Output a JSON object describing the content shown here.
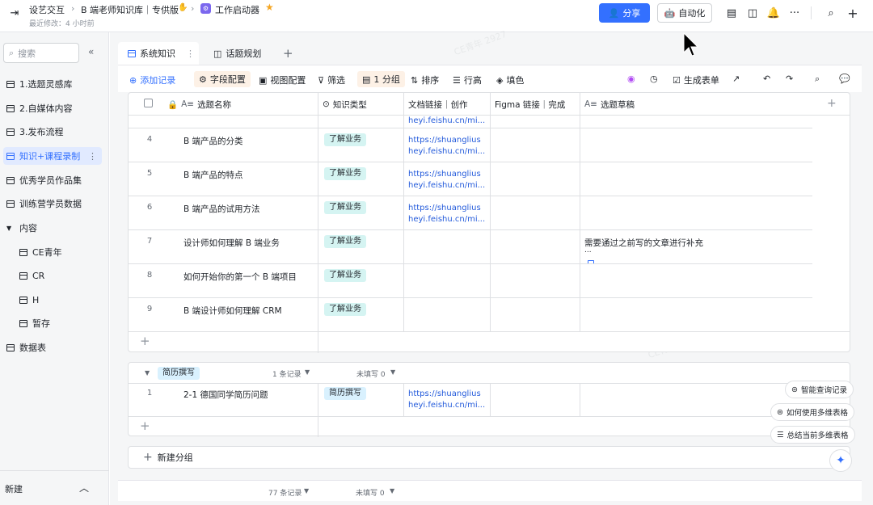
{
  "topbar": {
    "crumbs": [
      "设艺交互",
      "B 端老师知识库｜专供版",
      "工作启动器"
    ],
    "last_modified": "最近修改：4 小时前",
    "share_label": "分享",
    "automation_label": "自动化",
    "star_color": "#f5a623"
  },
  "sidebar": {
    "search_placeholder": "搜索",
    "items": [
      {
        "label": "1.选题灵感库"
      },
      {
        "label": "2.自媒体内容"
      },
      {
        "label": "3.发布流程"
      },
      {
        "label": "知识+课程录制"
      },
      {
        "label": "优秀学员作品集"
      },
      {
        "label": "训练营学员数据"
      },
      {
        "label": "内容"
      },
      {
        "label": "CE青年"
      },
      {
        "label": "CR"
      },
      {
        "label": "H"
      },
      {
        "label": "暂存"
      },
      {
        "label": "数据表"
      }
    ],
    "new_label": "新建"
  },
  "tabs": [
    {
      "label": "系统知识"
    },
    {
      "label": "话题规划"
    }
  ],
  "toolbar": {
    "add_record": "添加记录",
    "field_config": "字段配置",
    "view_config": "视图配置",
    "filter": "筛选",
    "group": "1 分组",
    "sort": "排序",
    "row_height": "行高",
    "fill_color": "填色",
    "generate_form": "生成表单"
  },
  "columns": [
    "选题名称",
    "知识类型",
    "文档链接｜创作",
    "Figma 链接｜完成",
    "选题草稿"
  ],
  "group1": {
    "partial_link": "heyi.feishu.cn/mi...",
    "rows": [
      {
        "num": "4",
        "title": "B 端产品的分类",
        "type": "了解业务",
        "link1": "https://shuanglius",
        "link2": "heyi.feishu.cn/mi...",
        "draft": ""
      },
      {
        "num": "5",
        "title": "B 端产品的特点",
        "type": "了解业务",
        "link1": "https://shuanglius",
        "link2": "heyi.feishu.cn/mi...",
        "draft": ""
      },
      {
        "num": "6",
        "title": "B 端产品的试用方法",
        "type": "了解业务",
        "link1": "https://shuanglius",
        "link2": "heyi.feishu.cn/mi...",
        "draft": ""
      },
      {
        "num": "7",
        "title": "设计师如何理解 B 端业务",
        "type": "了解业务",
        "link1": "",
        "link2": "",
        "draft": "需要通过之前写的文章进行补充",
        "draft_more": "..."
      },
      {
        "num": "8",
        "title": "如何开始你的第一个 B 端项目",
        "type": "了解业务",
        "link1": "",
        "link2": "",
        "draft": ""
      },
      {
        "num": "9",
        "title": "B 端设计师如何理解 CRM",
        "type": "了解业务",
        "link1": "",
        "link2": "",
        "draft": ""
      }
    ]
  },
  "group2": {
    "name": "简历撰写",
    "count": "1 条记录",
    "unfilled": "未填写 0",
    "rows": [
      {
        "num": "1",
        "title": "2-1 德国同学简历问题",
        "type": "简历撰写",
        "link1": "https://shuanglius",
        "link2": "heyi.feishu.cn/mi..."
      }
    ]
  },
  "new_group": "新建分组",
  "footer": {
    "count": "77 条记录",
    "unfilled": "未填写 0"
  },
  "float_buttons": [
    "智能查询记录",
    "如何使用多维表格",
    "总结当前多维表格"
  ],
  "watermark": "CE青年 2927"
}
